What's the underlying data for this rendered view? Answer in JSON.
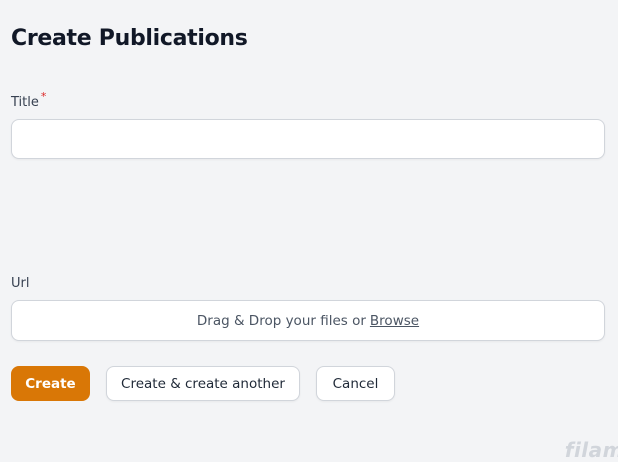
{
  "page": {
    "title": "Create Publications"
  },
  "form": {
    "title_field": {
      "label": "Title",
      "required_marker": "*",
      "value": "",
      "placeholder": ""
    },
    "url_field": {
      "label": "Url",
      "dropzone_text": "Drag & Drop your files or",
      "browse_label": "Browse"
    }
  },
  "actions": {
    "create_label": "Create",
    "create_another_label": "Create & create another",
    "cancel_label": "Cancel"
  },
  "branding": {
    "watermark": "filam"
  },
  "colors": {
    "primary": "#d97706",
    "background": "#f3f4f6",
    "required": "#dc2626"
  }
}
